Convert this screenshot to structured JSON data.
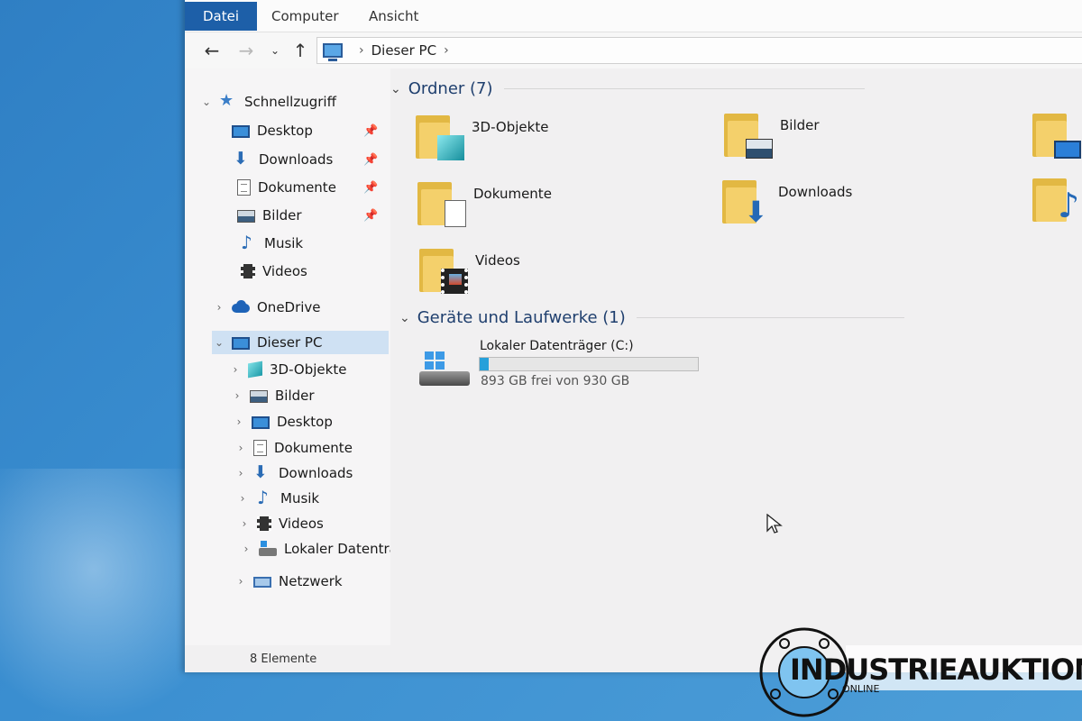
{
  "ribbon": {
    "tabs": [
      "Datei",
      "Computer",
      "Ansicht"
    ]
  },
  "address": {
    "crumbs": [
      "Dieser PC"
    ]
  },
  "sidebar": {
    "quick_access": "Schnellzugriff",
    "quick_items": [
      "Desktop",
      "Downloads",
      "Dokumente",
      "Bilder",
      "Musik",
      "Videos"
    ],
    "onedrive": "OneDrive",
    "this_pc": "Dieser PC",
    "pc_items": [
      "3D-Objekte",
      "Bilder",
      "Desktop",
      "Dokumente",
      "Downloads",
      "Musik",
      "Videos",
      "Lokaler Datenträger"
    ],
    "network": "Netzwerk"
  },
  "content": {
    "folders_header": "Ordner (7)",
    "folders": [
      "3D-Objekte",
      "Bilder",
      "Dokumente",
      "Downloads",
      "Videos"
    ],
    "drives_header": "Geräte und Laufwerke (1)",
    "drive": {
      "name": "Lokaler Datenträger (C:)",
      "free_text": "893 GB frei von 930 GB",
      "used_fraction": 0.04
    }
  },
  "status": {
    "count": "8 Elemente"
  },
  "watermark": {
    "brand": "INDUSTRIEAUKTION",
    "sub": "ONLINE"
  },
  "colors": {
    "accent": "#1d5fa8",
    "drive_fill": "#26a0da",
    "folder": "#f4d06b"
  }
}
